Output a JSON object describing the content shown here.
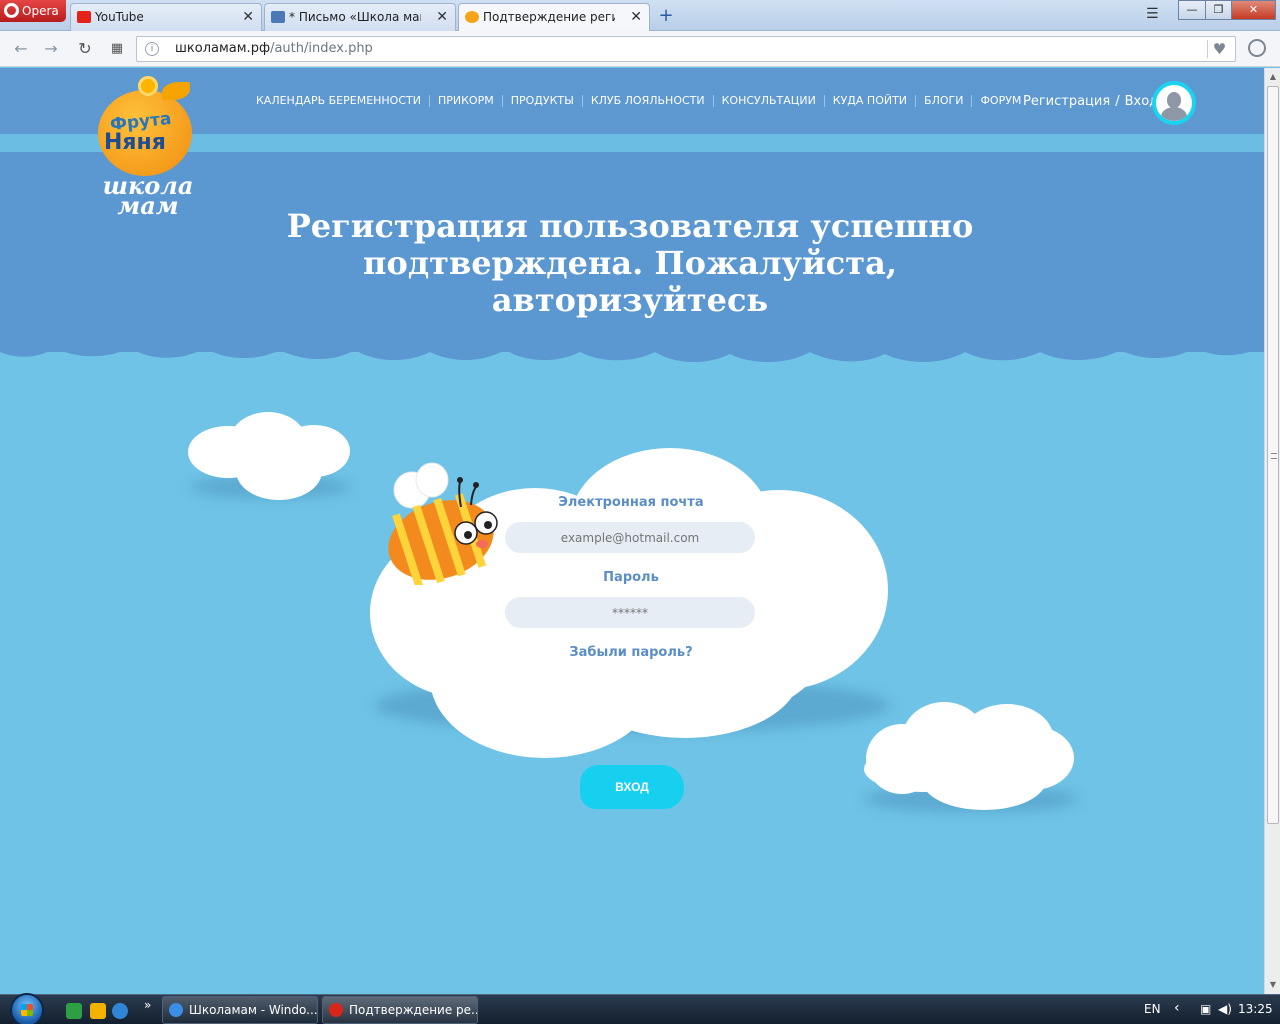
{
  "browser": {
    "menu_label": "Opera",
    "tabs": [
      {
        "label": "YouTube",
        "close": "✕"
      },
      {
        "label": "* Письмо «Школа мам: П",
        "close": "✕"
      },
      {
        "label": "Подтверждение регистра",
        "close": "✕"
      }
    ],
    "new_tab": "+",
    "window": {
      "minimize": "—",
      "restore": "❐",
      "close": "✕"
    },
    "url_host": "школамам.рф",
    "url_path": "/auth/index.php",
    "info_icon": "i",
    "heart": "♥"
  },
  "site": {
    "logo": {
      "brand_line1": "Фрута",
      "brand_line2": "Няня",
      "school_line1": "школа",
      "school_line2": "мам"
    },
    "nav": [
      "КАЛЕНДАРЬ БЕРЕМЕННОСТИ",
      "ПРИКОРМ",
      "ПРОДУКТЫ",
      "КЛУБ ЛОЯЛЬНОСТИ",
      "КОНСУЛЬТАЦИИ",
      "КУДА ПОЙТИ",
      "БЛОГИ",
      "ФОРУМ"
    ],
    "auth": {
      "register": "Регистрация",
      "separator": "/",
      "login": "Вход"
    },
    "hero_title": "Регистрация пользователя успешно подтверждена. Пожалуйста, авторизуйтесь",
    "form": {
      "email_label": "Электронная почта",
      "email_placeholder": "example@hotmail.com",
      "password_label": "Пароль",
      "password_placeholder": "******",
      "forgot": "Забыли пароль?",
      "submit": "ВХОД"
    },
    "colors": {
      "hero": "#5b97d0",
      "sky": "#6ec3e6",
      "button": "#17d0ef",
      "label": "#5b8ec4"
    }
  },
  "taskbar": {
    "chevron": "»",
    "windows": [
      {
        "label": "Школамам - Windo..."
      },
      {
        "label": "Подтверждение ре..."
      }
    ],
    "lang": "EN",
    "tray_arrow": "‹",
    "clock": "13:25"
  }
}
